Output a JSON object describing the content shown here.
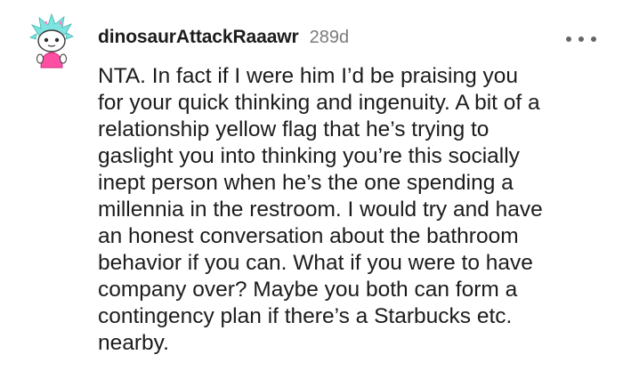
{
  "comment": {
    "username": "dinosaurAttackRaaawr",
    "age": "289d",
    "more_icon": "more-horizontal-icon",
    "avatar_icon": "reddit-snoo-avatar-icon",
    "body_lines": [
      "NTA. In fact if I were him I’d be praising you",
      "for your quick thinking and ingenuity. A bit of a",
      "relationship yellow flag that he’s trying to",
      "gaslight you into thinking you’re this socially",
      "inept person when he’s the one spending a",
      "millennia in the restroom. I would try and have",
      "an honest conversation about the bathroom",
      "behavior if you can. What if you were to have",
      "company over? Maybe you both can form a",
      "contingency plan if there’s a Starbucks etc.",
      "nearby."
    ]
  },
  "colors": {
    "username": "#1c1c1c",
    "age": "#7c7c7c",
    "body": "#1c1c1c",
    "avatar_hair": "#7fe3df",
    "avatar_shirt": "#ff4fa3"
  }
}
